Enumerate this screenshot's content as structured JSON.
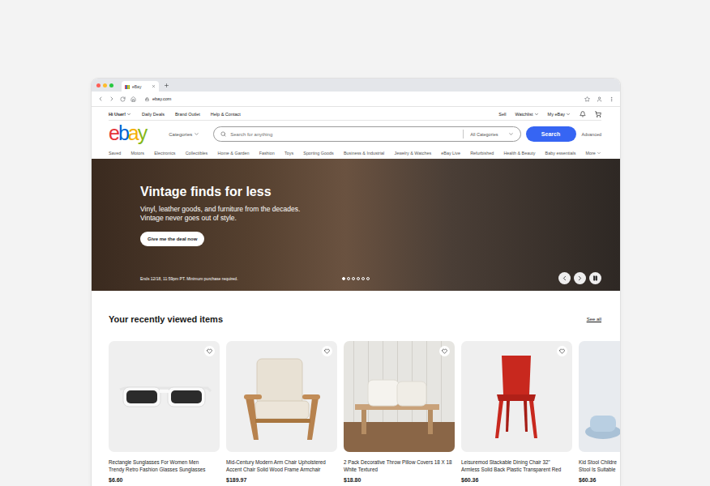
{
  "browser": {
    "tab": {
      "title": "eBay",
      "selected": true
    },
    "address": "ebay.com"
  },
  "top_nav": {
    "greeting": {
      "label": "Hi User!",
      "menu": true
    },
    "left": [
      "Daily Deals",
      "Brand Outlet",
      "Help & Contact"
    ],
    "right": [
      {
        "label": "Sell",
        "menu": false
      },
      {
        "label": "Watchlist",
        "menu": true
      },
      {
        "label": "My eBay",
        "menu": true
      }
    ]
  },
  "header": {
    "logo": [
      {
        "letter": "e",
        "color": "#e53238"
      },
      {
        "letter": "b",
        "color": "#0064d2"
      },
      {
        "letter": "a",
        "color": "#f5af02"
      },
      {
        "letter": "y",
        "color": "#86b817"
      }
    ],
    "categories": "Categories",
    "search": {
      "placeholder": "Search for anything",
      "category": "All Categories",
      "button": "Search"
    },
    "advanced": "Advanced"
  },
  "category_nav": [
    {
      "label": "Saved",
      "menu": false
    },
    {
      "label": "Motors",
      "menu": false
    },
    {
      "label": "Electronics",
      "menu": false
    },
    {
      "label": "Collectibles",
      "menu": false
    },
    {
      "label": "Home & Garden",
      "menu": false
    },
    {
      "label": "Fashion",
      "menu": false
    },
    {
      "label": "Toys",
      "menu": false
    },
    {
      "label": "Sporting Goods",
      "menu": false
    },
    {
      "label": "Business & Industrial",
      "menu": false
    },
    {
      "label": "Jewelry & Watches",
      "menu": false
    },
    {
      "label": "eBay Live",
      "menu": false
    },
    {
      "label": "Refurbished",
      "menu": false
    },
    {
      "label": "Health & Beauty",
      "menu": false
    },
    {
      "label": "Baby essentials",
      "menu": false
    },
    {
      "label": "More",
      "menu": true
    }
  ],
  "hero": {
    "title": "Vintage finds for less",
    "subtitle": "Vinyl, leather goods, and furniture from the decades. Vintage never goes out of style.",
    "button": "Give me the deal now",
    "fine_print": "Ends 12/18, 11:59pm PT. Minimum purchase required.",
    "slides": [
      {
        "selected": true
      },
      {
        "selected": false
      },
      {
        "selected": false
      },
      {
        "selected": false
      },
      {
        "selected": false
      },
      {
        "selected": false
      }
    ],
    "playing": true
  },
  "recently_viewed": {
    "title": "Your recently viewed items",
    "see_all": "See all",
    "items": [
      {
        "title_lines": [
          "Rectangle Sunglasses For Women Men",
          "Trendy Retro Fashion Glasses Sunglasses"
        ],
        "price": "$6.60",
        "watched": false
      },
      {
        "title_lines": [
          "Mid-Century Modern Arm Chair Upholstered",
          "Accent Chair Solid Wood Frame Armchair"
        ],
        "price": "$189.97",
        "watched": false
      },
      {
        "title_lines": [
          "2 Pack Decorative Throw Pillow Covers 18 X 18",
          "White Textured"
        ],
        "price": "$18.80",
        "watched": false
      },
      {
        "title_lines": [
          "Leisuremod Stackable Dining Chair 32\"",
          "Armless Solid Back Plastic Transparent Red"
        ],
        "price": "$60.36",
        "watched": false
      },
      {
        "title_lines": [
          "Kid Stool Childre",
          "Stool Is Suitable"
        ],
        "price": "$60.36",
        "watched": false
      }
    ]
  }
}
